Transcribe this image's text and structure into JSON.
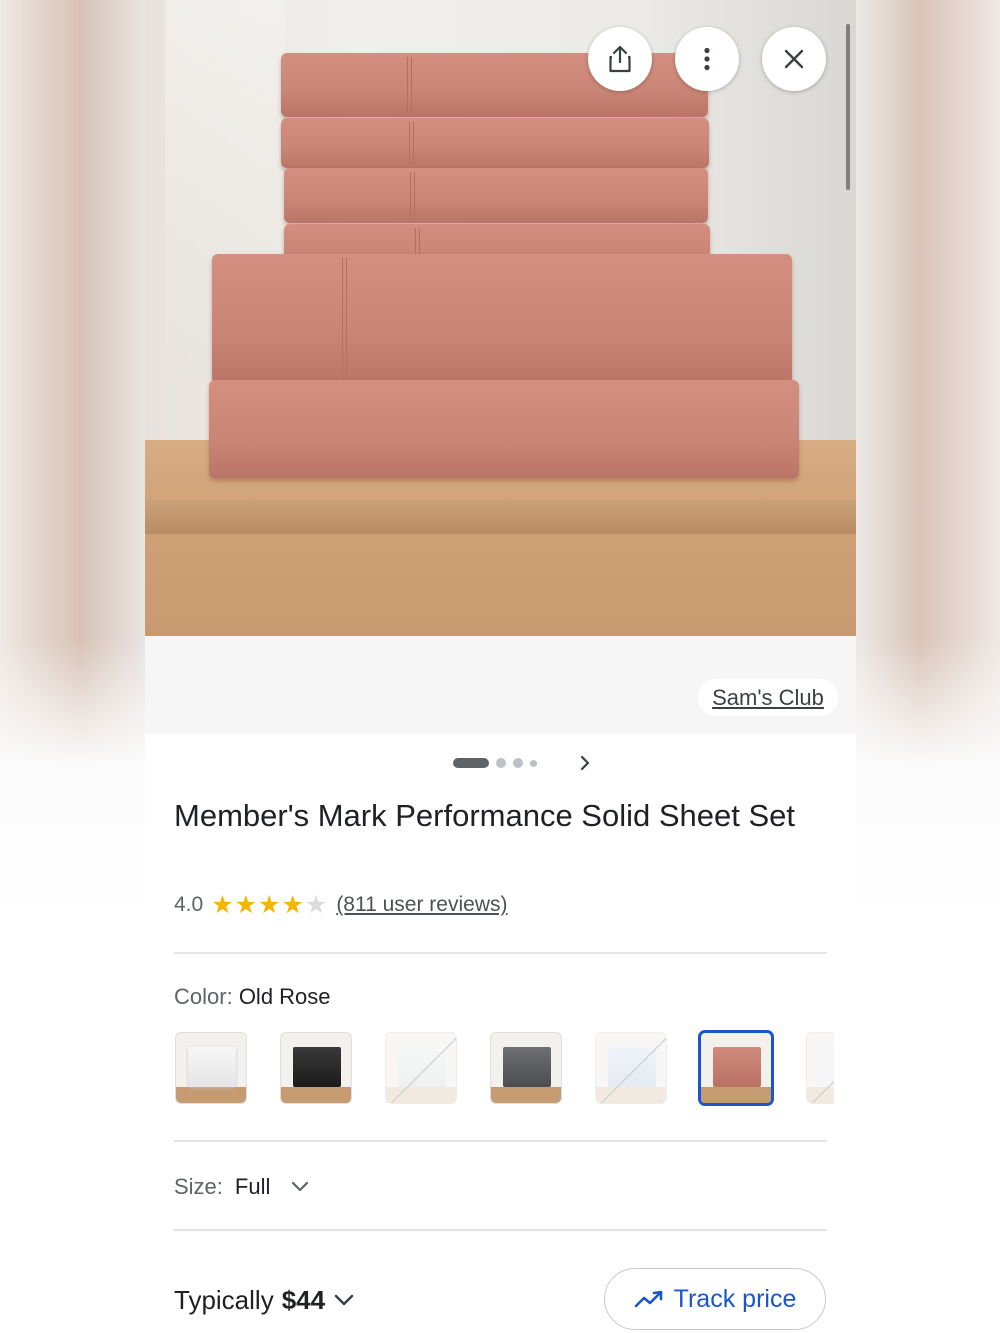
{
  "toolbar": {
    "share_icon": "share-icon",
    "more_icon": "more-vert-icon",
    "close_icon": "close-icon"
  },
  "gallery": {
    "merchant": "Sam's Club",
    "page_indicator": {
      "current": 1,
      "total": 4
    },
    "next_icon": "chevron-right-icon"
  },
  "product": {
    "title": "Member's Mark Performance Solid Sheet Set",
    "rating": "4.0",
    "rating_value": 4.0,
    "reviews": "(811 user reviews)"
  },
  "color": {
    "label": "Color:",
    "selected": "Old Rose",
    "swatch_count_visible": 7
  },
  "size": {
    "label": "Size:",
    "selected": "Full"
  },
  "price": {
    "prefix": "Typically",
    "value": "$44"
  },
  "track": {
    "label": "Track price"
  },
  "colors": {
    "accent": "#1a56c9",
    "sheet": "#c98576",
    "star": "#f5b400"
  }
}
